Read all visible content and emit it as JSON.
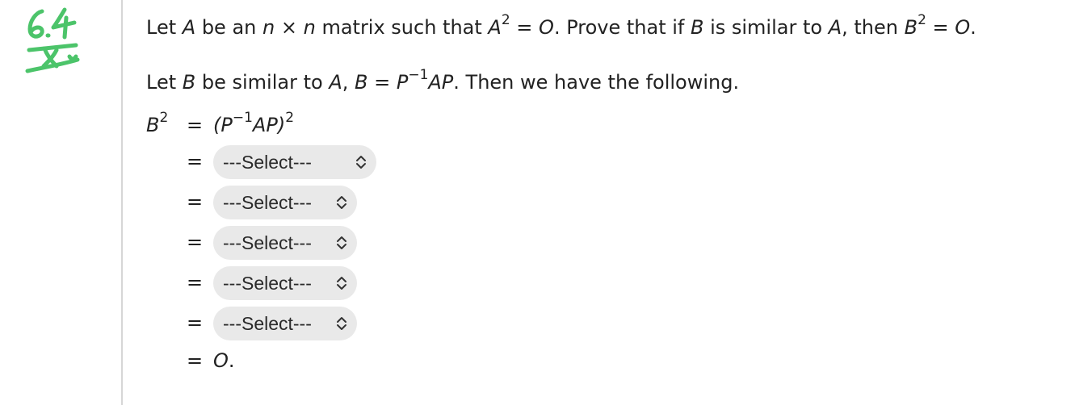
{
  "problem": {
    "t1": "Let ",
    "A": "A",
    "t2": " be an ",
    "n1": "n",
    "times": " × ",
    "n2": "n",
    "t3": " matrix such that ",
    "A2": "A",
    "sq1": "2",
    "t4": " = ",
    "O1": "O",
    "t5": ". Prove that if ",
    "B1": "B",
    "t6": " is similar to ",
    "A3": "A",
    "t7": ", then ",
    "B2": "B",
    "sq2": "2",
    "t8": " = ",
    "O2": "O",
    "t9": "."
  },
  "intro": {
    "t1": "Let ",
    "B1": "B",
    "t2": " be similar to ",
    "A1": "A",
    "t3": ", ",
    "B2": "B",
    "t4": " = ",
    "P1": "P",
    "inv": "−1",
    "AP": "AP",
    "t5": ". Then we have the following."
  },
  "derivation": {
    "lhs_B": "B",
    "lhs_sq": "2",
    "equals": "=",
    "first_rhs": {
      "open": "(",
      "P": "P",
      "inv": "−1",
      "AP": "AP",
      "close": ")",
      "sq": "2"
    },
    "selects": [
      "---Select---",
      "---Select---",
      "---Select---",
      "---Select---",
      "---Select---"
    ],
    "final_rhs": {
      "O": "O",
      "period": "."
    }
  },
  "annotation": {
    "color": "#4cc46a",
    "text": "6.4"
  }
}
